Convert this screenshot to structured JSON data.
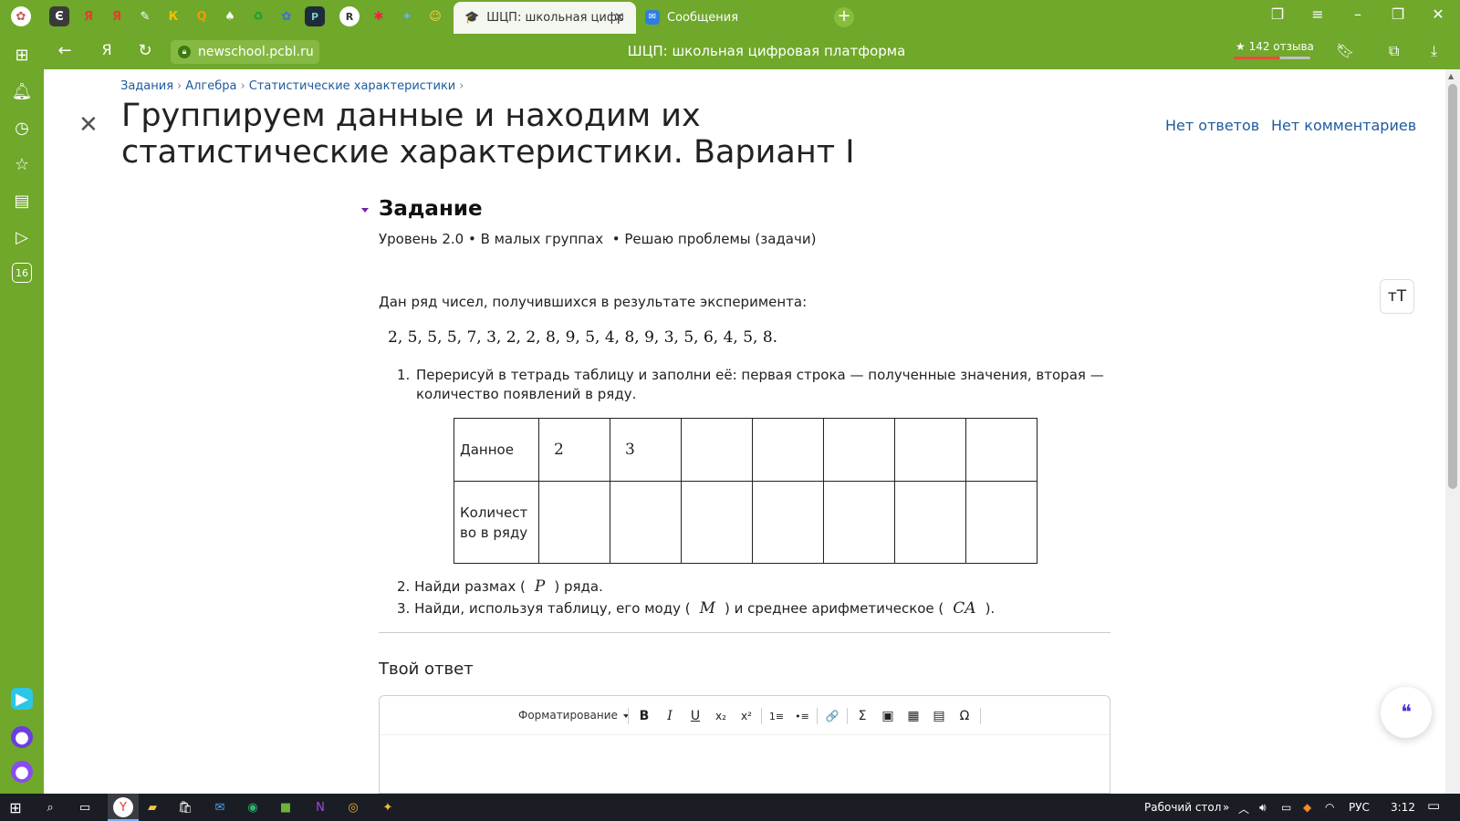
{
  "browser": {
    "active_tab_title": "ШЦП: школьная цифровая платформа",
    "second_tab_title": "Сообщения",
    "url": "newschool.pcbl.ru",
    "page_title": "ШЦП: школьная цифровая платформа",
    "reviews": "★ 142 отзыва",
    "left_rail_badge": "16",
    "pinned_tab_glyphs": [
      "Є",
      "Я",
      "Я",
      "✎",
      "К",
      "Q",
      "♠",
      "♻",
      "✿",
      "Р",
      "R",
      "✱",
      "✦",
      "☺"
    ]
  },
  "breadcrumb": [
    "Задания",
    "Алгебра",
    "Статистические характеристики"
  ],
  "title": "Группируем данные и находим их статистические характеристики. Вариант I",
  "top_links": {
    "answers": "Нет ответов",
    "comments": "Нет комментариев"
  },
  "task": {
    "heading": "Задание",
    "meta": "Уровень 2.0 • В малых группах  • Решаю проблемы (задачи)",
    "intro": "Дан ряд чисел, получившихся в результате эксперимента:",
    "series": "2, 5, 5, 5, 7, 3, 2, 2, 8, 9, 5, 4, 8, 9, 3, 5, 6, 4, 5, 8.",
    "item1": "1. Перерисуй в тетрадь таблицу и заполни её: первая строка — полученные значения, вторая — количество появлений в ряду.",
    "item1_line1": "Перерисуй в тетрадь таблицу и заполни её: первая строка — полученные значения, вторая —",
    "item1_line2": "количество появлений в ряду.",
    "item1_num": "1.",
    "table": {
      "row1_label": "Данное",
      "row2_label_line1": "Количест",
      "row2_label_line2": "во в ряду",
      "row1_values": [
        "2",
        "3",
        "",
        "",
        "",
        "",
        ""
      ],
      "row2_values": [
        "",
        "",
        "",
        "",
        "",
        "",
        ""
      ]
    },
    "item2": {
      "num": "2.",
      "before": "Найди размах (",
      "math": "P",
      "after": ") ряда."
    },
    "item3": {
      "num": "3.",
      "before": "Найди, используя таблицу, его моду (",
      "math1": "M",
      "middle": ") и среднее арифметическое (",
      "math2": "CA",
      "after": ")."
    }
  },
  "answer": {
    "label": "Твой ответ",
    "format_dropdown": "Форматирование",
    "toolbar": [
      "B",
      "I",
      "U",
      "x₂",
      "x²",
      "1≡",
      "•≡",
      "🔗",
      "Σ",
      "▣",
      "▦",
      "▤",
      "Ω"
    ]
  },
  "taskbar": {
    "desktop_label": "Рабочий стол",
    "language": "РУС",
    "time": "3:12"
  },
  "colors": {
    "chrome_green": "#6fa82a",
    "link_blue": "#1e5a9e",
    "taskbar": "#1b1d24"
  }
}
